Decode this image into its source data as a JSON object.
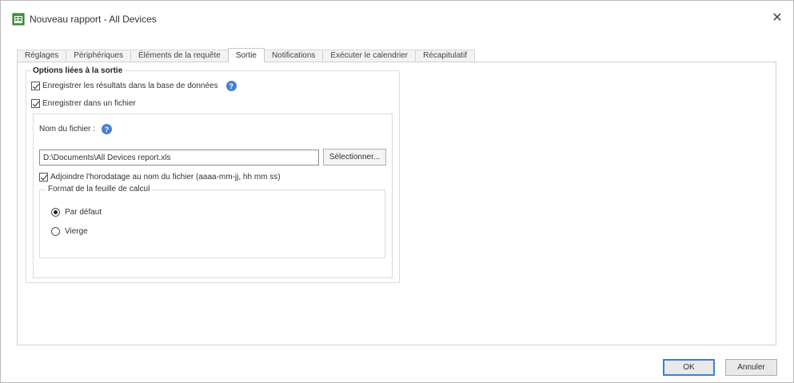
{
  "window": {
    "title": "Nouveau rapport - All Devices",
    "app_icon": "report-icon",
    "close_glyph": "✕"
  },
  "tabs": [
    {
      "label": "Réglages",
      "active": false
    },
    {
      "label": "Périphériques",
      "active": false
    },
    {
      "label": "Éléments de la requête",
      "active": false
    },
    {
      "label": "Sortie",
      "active": true
    },
    {
      "label": "Notifications",
      "active": false
    },
    {
      "label": "Exécuter le calendrier",
      "active": false
    },
    {
      "label": "Récapitulatif",
      "active": false
    }
  ],
  "output": {
    "group_title": "Options liées à la sortie",
    "save_db_label": "Enregistrer les résultats dans la base de données",
    "save_db_checked": true,
    "save_file_label": "Enregistrer dans un fichier",
    "save_file_checked": true,
    "filename_label": "Nom du fichier :",
    "filename_value": "D:\\Documents\\All Devices report.xls",
    "select_button": "Sélectionner...",
    "timestamp_label": "Adjoindre l'horodatage au nom du fichier (aaaa-mm-jj, hh mm ss)",
    "timestamp_checked": true,
    "format_legend": "Format de la feuille de calcul",
    "format_options": [
      {
        "label": "Par défaut",
        "selected": true
      },
      {
        "label": "Vierge",
        "selected": false
      }
    ]
  },
  "footer": {
    "ok": "OK",
    "cancel": "Annuler"
  },
  "colors": {
    "help_icon": "#4a7fd0",
    "ok_border": "#3c7fd6"
  }
}
